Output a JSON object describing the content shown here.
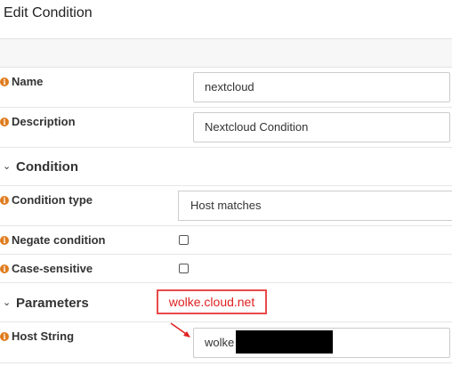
{
  "dialog": {
    "title": "Edit Condition"
  },
  "fields": {
    "name": {
      "label": "Name",
      "value": "nextcloud"
    },
    "description": {
      "label": "Description",
      "value": "Nextcloud Condition"
    },
    "condition_type": {
      "label": "Condition type",
      "value": "Host matches"
    },
    "negate": {
      "label": "Negate condition",
      "checked": false
    },
    "case_sensitive": {
      "label": "Case-sensitive",
      "checked": false
    },
    "host_string": {
      "label": "Host String",
      "value": "wolke"
    }
  },
  "sections": {
    "condition": "Condition",
    "parameters": "Parameters"
  },
  "annotation": {
    "text": "wolke.cloud.net",
    "color": "#e02020"
  },
  "colors": {
    "info_icon": "#e07c1e",
    "annotation_red": "#e84a4a"
  }
}
